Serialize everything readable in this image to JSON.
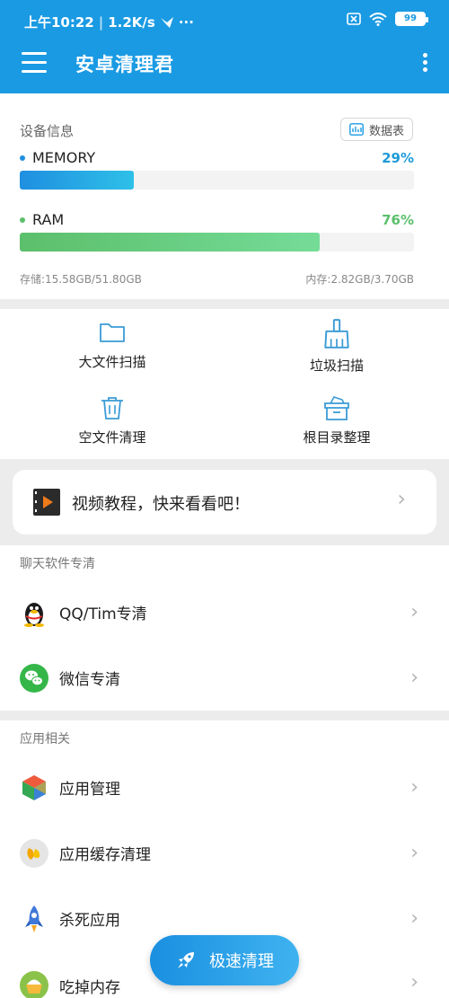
{
  "status_bar": {
    "time": "上午10:22",
    "speed": "1.2K/s",
    "dots": "···",
    "battery": "99"
  },
  "app_bar": {
    "title": "安卓清理君"
  },
  "device": {
    "heading": "设备信息",
    "datatable_label": "数据表",
    "memory": {
      "label": "MEMORY",
      "percent_text": "29%",
      "percent": 29,
      "color": "#1f8fe0"
    },
    "ram": {
      "label": "RAM",
      "percent_text": "76%",
      "percent": 76,
      "color": "#5cbf6b"
    },
    "storage": "存储:15.58GB/51.80GB",
    "memory_info": "内存:2.82GB/3.70GB"
  },
  "tools": [
    {
      "label": "大文件扫描",
      "icon": "folder-icon"
    },
    {
      "label": "垃圾扫描",
      "icon": "broom-icon"
    },
    {
      "label": "空文件清理",
      "icon": "trash-icon"
    },
    {
      "label": "根目录整理",
      "icon": "box-icon"
    }
  ],
  "video": {
    "label": "视频教程，快来看看吧！",
    "chevron": "›"
  },
  "chat_section": {
    "heading": "聊天软件专清",
    "items": [
      {
        "label": "QQ/Tim专清",
        "icon": "qq-penguin-icon"
      },
      {
        "label": "微信专清",
        "icon": "wechat-icon"
      }
    ]
  },
  "app_section": {
    "heading": "应用相关",
    "items": [
      {
        "label": "应用管理",
        "icon": "cube-icon"
      },
      {
        "label": "应用缓存清理",
        "icon": "cache-icon"
      },
      {
        "label": "杀死应用",
        "icon": "rocket-icon"
      },
      {
        "label": "吃掉内存",
        "icon": "memory-eat-icon"
      }
    ]
  },
  "fab": {
    "label": "极速清理",
    "icon": "rocket-icon"
  },
  "colors": {
    "primary": "#1a9ae3",
    "memory": "#1f8fe0",
    "ram": "#5cbf6b"
  }
}
